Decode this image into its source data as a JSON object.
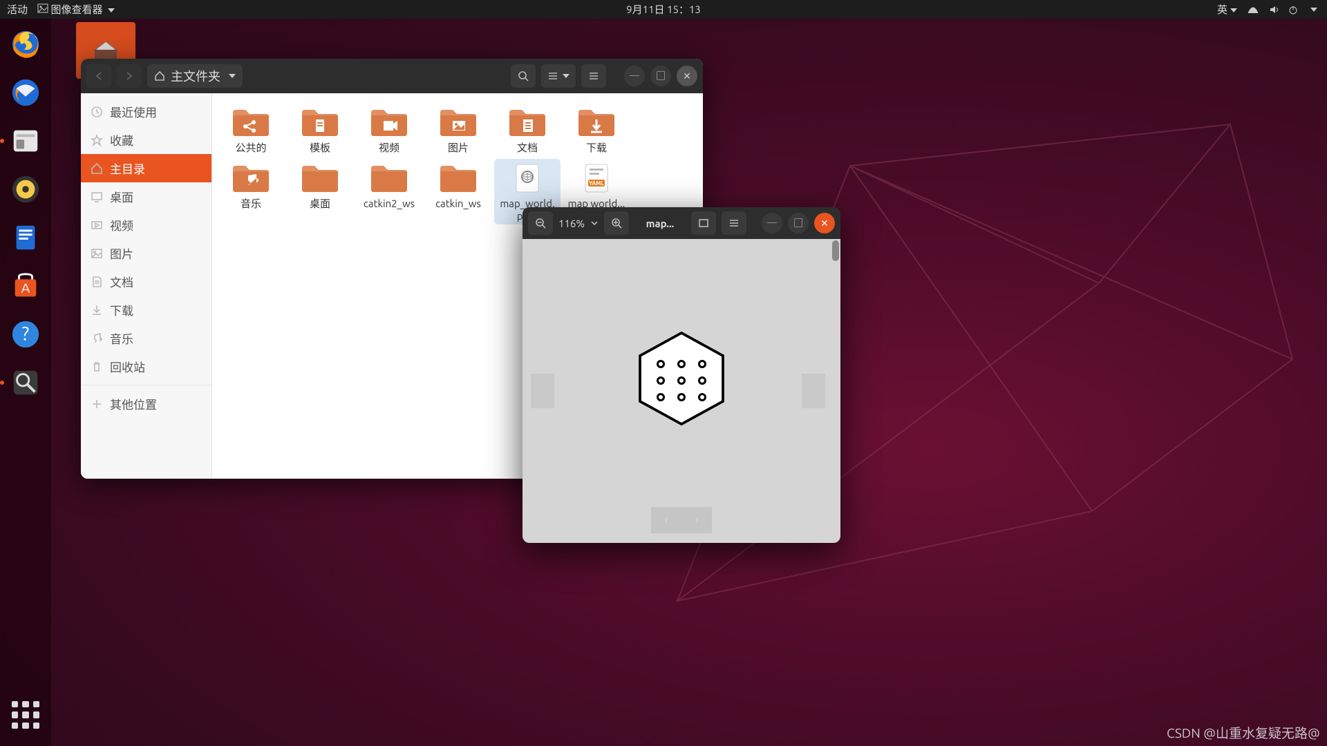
{
  "panel": {
    "activities": "活动",
    "app_menu": "图像查看器",
    "datetime": "9月11日 15：13",
    "ime": "英"
  },
  "desktop": {
    "home_icon": "home-folder"
  },
  "files": {
    "path_label": "主文件夹",
    "sidebar": [
      {
        "icon": "clock",
        "label": "最近使用"
      },
      {
        "icon": "star",
        "label": "收藏"
      },
      {
        "icon": "home",
        "label": "主目录",
        "active": true
      },
      {
        "icon": "desktop",
        "label": "桌面"
      },
      {
        "icon": "video",
        "label": "视频"
      },
      {
        "icon": "image",
        "label": "图片"
      },
      {
        "icon": "doc",
        "label": "文档"
      },
      {
        "icon": "download",
        "label": "下载"
      },
      {
        "icon": "music",
        "label": "音乐"
      },
      {
        "icon": "trash",
        "label": "回收站"
      },
      {
        "icon": "plus",
        "label": "其他位置",
        "sep_before": true
      }
    ],
    "items": [
      {
        "type": "folder-share",
        "label": "公共的"
      },
      {
        "type": "folder-template",
        "label": "模板"
      },
      {
        "type": "folder-video",
        "label": "视频"
      },
      {
        "type": "folder-image",
        "label": "图片"
      },
      {
        "type": "folder-doc",
        "label": "文档"
      },
      {
        "type": "folder-download",
        "label": "下载"
      },
      {
        "type": "folder-music",
        "label": "音乐"
      },
      {
        "type": "folder-plain",
        "label": "桌面"
      },
      {
        "type": "folder-plain",
        "label": "catkin2_ws"
      },
      {
        "type": "folder-plain",
        "label": "catkin_ws"
      },
      {
        "type": "file-pgm",
        "label": "map_world.pgm",
        "selected": true
      },
      {
        "type": "file-yaml",
        "label": "map world..."
      }
    ]
  },
  "viewer": {
    "zoom": "116%",
    "title": "map..."
  },
  "watermark": "CSDN @山重水复疑无路@"
}
